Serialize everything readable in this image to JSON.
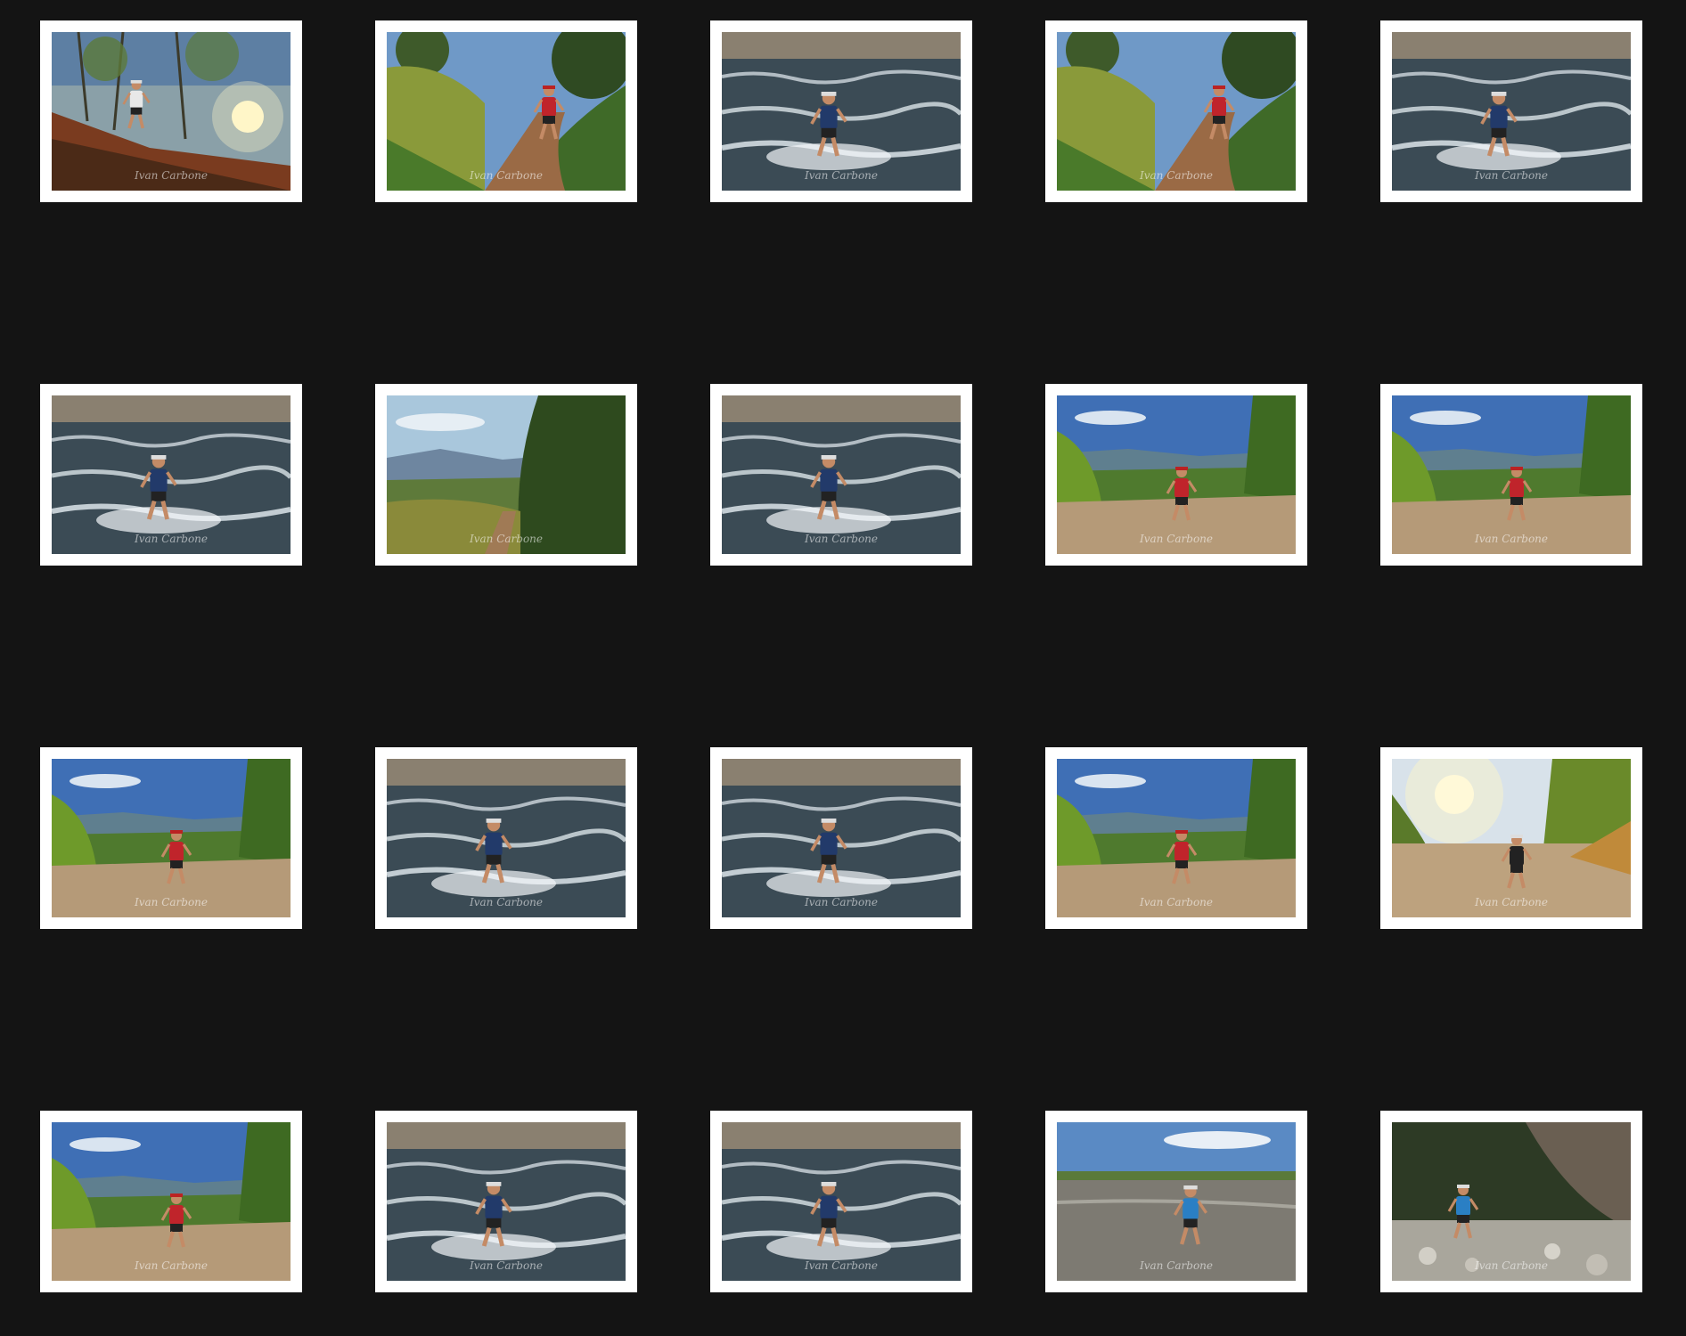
{
  "gallery": {
    "photos": [
      {
        "scene": "forest-trail-sunset",
        "watermark": "Ivan Carbone"
      },
      {
        "scene": "forest-trail-runner",
        "watermark": "Ivan Carbone"
      },
      {
        "scene": "river-crossing",
        "watermark": "Ivan Carbone"
      },
      {
        "scene": "forest-trail-runner",
        "watermark": "Ivan Carbone"
      },
      {
        "scene": "river-crossing",
        "watermark": "Ivan Carbone"
      },
      {
        "scene": "river-crossing",
        "watermark": "Ivan Carbone"
      },
      {
        "scene": "mountain-vista",
        "watermark": "Ivan Carbone"
      },
      {
        "scene": "river-crossing",
        "watermark": "Ivan Carbone"
      },
      {
        "scene": "dirt-road-runner",
        "watermark": "Ivan Carbone"
      },
      {
        "scene": "dirt-road-runner",
        "watermark": "Ivan Carbone"
      },
      {
        "scene": "dirt-road-runner",
        "watermark": "Ivan Carbone"
      },
      {
        "scene": "river-crossing",
        "watermark": "Ivan Carbone"
      },
      {
        "scene": "river-crossing",
        "watermark": "Ivan Carbone"
      },
      {
        "scene": "dirt-road-runner",
        "watermark": "Ivan Carbone"
      },
      {
        "scene": "dirt-road-sunset",
        "watermark": "Ivan Carbone"
      },
      {
        "scene": "dirt-road-runner",
        "watermark": "Ivan Carbone"
      },
      {
        "scene": "river-crossing",
        "watermark": "Ivan Carbone"
      },
      {
        "scene": "river-crossing",
        "watermark": "Ivan Carbone"
      },
      {
        "scene": "beach-runner",
        "watermark": "Ivan Carbone"
      },
      {
        "scene": "rocky-riverbed",
        "watermark": "Ivan Carbone"
      }
    ]
  },
  "colors": {
    "background": "#141414",
    "frame": "#ffffff"
  }
}
